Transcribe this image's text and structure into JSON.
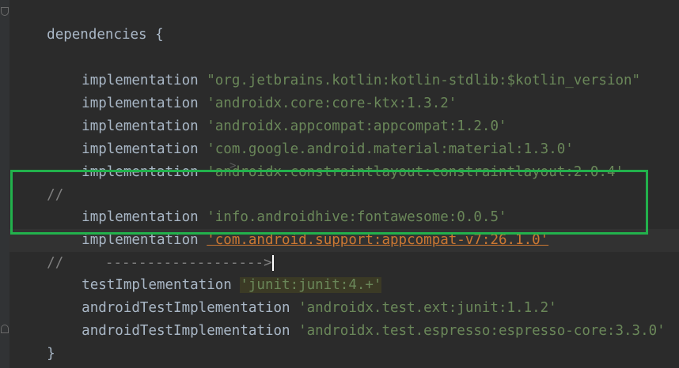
{
  "editor": {
    "language": "gradle",
    "colors": {
      "background": "#2b2b2b",
      "text": "#a9b7c6",
      "string": "#6a8759",
      "warning_string": "#cc7832",
      "comment": "#808080",
      "highlight_box": "#22b14c"
    },
    "lines": [
      {
        "kind": "block-open",
        "text": "dependencies {"
      },
      {
        "kind": "blank",
        "text": ""
      },
      {
        "kind": "dep",
        "keyword": "implementation",
        "value": "\"org.jetbrains.kotlin:kotlin-stdlib:$kotlin_version\""
      },
      {
        "kind": "dep",
        "keyword": "implementation",
        "value": "'androidx.core:core-ktx:1.3.2'"
      },
      {
        "kind": "dep",
        "keyword": "implementation",
        "value": "'androidx.appcompat:appcompat:1.2.0'"
      },
      {
        "kind": "dep",
        "keyword": "implementation",
        "value": "'com.google.android.material:material:1.3.0'"
      },
      {
        "kind": "dep",
        "keyword": "implementation",
        "value": "'androidx.constraintlayout:constraintlayout:2.0.4'"
      },
      {
        "kind": "comment",
        "text": "//"
      },
      {
        "kind": "dep",
        "keyword": "implementation",
        "value": "'info.androidhive:fontawesome:0.0.5'"
      },
      {
        "kind": "dep",
        "keyword": "implementation",
        "value": "'com.android.support:appcompat-v7:26.1.0'"
      },
      {
        "kind": "comment",
        "text": "//     ------------------->"
      },
      {
        "kind": "dep",
        "keyword": "testImplementation",
        "value": "'junit:junit:4.+'"
      },
      {
        "kind": "dep",
        "keyword": "androidTestImplementation",
        "value": "'androidx.test.ext:junit:1.1.2'"
      },
      {
        "kind": "dep",
        "keyword": "androidTestImplementation",
        "value": "'androidx.test.espresso:espresso-core:3.3.0'"
      },
      {
        "kind": "blank",
        "text": ""
      },
      {
        "kind": "block-close",
        "text": "}"
      }
    ]
  }
}
